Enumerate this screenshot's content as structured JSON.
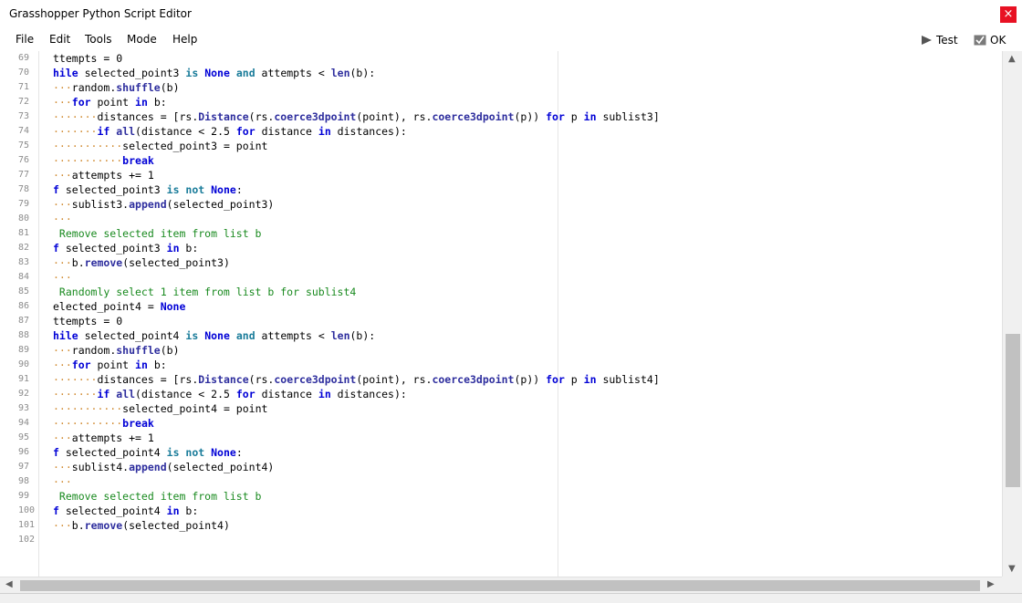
{
  "window": {
    "title": "Grasshopper Python Script Editor",
    "close_glyph": "×"
  },
  "menu": {
    "items": [
      "File",
      "Edit",
      "Tools",
      "Mode",
      "Help"
    ]
  },
  "toolbar": {
    "test_label": "Test",
    "ok_label": "OK"
  },
  "editor": {
    "lines": [
      {
        "n": "69",
        "segs": [
          [
            "",
            "ttempts = "
          ],
          [
            "num",
            "0"
          ]
        ]
      },
      {
        "n": "70",
        "segs": [
          [
            "kw",
            "hile"
          ],
          [
            "",
            " selected_point3 "
          ],
          [
            "ops",
            "is"
          ],
          [
            "",
            " "
          ],
          [
            "kw",
            "None"
          ],
          [
            "",
            " "
          ],
          [
            "ops",
            "and"
          ],
          [
            "",
            " attempts < "
          ],
          [
            "fn",
            "len"
          ],
          [
            "",
            "(b):"
          ]
        ]
      },
      {
        "n": "71",
        "segs": [
          [
            "ws",
            "···"
          ],
          [
            "",
            "random."
          ],
          [
            "fn",
            "shuffle"
          ],
          [
            "",
            "(b)"
          ]
        ]
      },
      {
        "n": "72",
        "segs": [
          [
            "ws",
            "···"
          ],
          [
            "kw",
            "for"
          ],
          [
            "",
            " point "
          ],
          [
            "kw",
            "in"
          ],
          [
            "",
            " b:"
          ]
        ]
      },
      {
        "n": "73",
        "segs": [
          [
            "ws",
            "·······"
          ],
          [
            "",
            "distances = [rs."
          ],
          [
            "fn",
            "Distance"
          ],
          [
            "",
            "(rs."
          ],
          [
            "fn",
            "coerce3dpoint"
          ],
          [
            "",
            "(point), rs."
          ],
          [
            "fn",
            "coerce3dpoint"
          ],
          [
            "",
            "(p)) "
          ],
          [
            "kw",
            "for"
          ],
          [
            "",
            " p "
          ],
          [
            "kw",
            "in"
          ],
          [
            "",
            " sublist3]"
          ]
        ]
      },
      {
        "n": "74",
        "segs": [
          [
            "ws",
            "·······"
          ],
          [
            "kw",
            "if"
          ],
          [
            "",
            " "
          ],
          [
            "fn",
            "all"
          ],
          [
            "",
            "(distance < "
          ],
          [
            "num",
            "2.5"
          ],
          [
            "",
            " "
          ],
          [
            "kw",
            "for"
          ],
          [
            "",
            " distance "
          ],
          [
            "kw",
            "in"
          ],
          [
            "",
            " distances):"
          ]
        ]
      },
      {
        "n": "75",
        "segs": [
          [
            "ws",
            "···········"
          ],
          [
            "",
            "selected_point3 = point"
          ]
        ]
      },
      {
        "n": "76",
        "segs": [
          [
            "ws",
            "···········"
          ],
          [
            "kw",
            "break"
          ]
        ]
      },
      {
        "n": "77",
        "segs": [
          [
            "ws",
            "···"
          ],
          [
            "",
            "attempts += "
          ],
          [
            "num",
            "1"
          ]
        ]
      },
      {
        "n": "78",
        "segs": [
          [
            "kw",
            "f"
          ],
          [
            "",
            " selected_point3 "
          ],
          [
            "ops",
            "is not"
          ],
          [
            "",
            " "
          ],
          [
            "kw",
            "None"
          ],
          [
            "",
            ":"
          ]
        ]
      },
      {
        "n": "79",
        "segs": [
          [
            "ws",
            "···"
          ],
          [
            "",
            "sublist3."
          ],
          [
            "fn",
            "append"
          ],
          [
            "",
            "(selected_point3)"
          ]
        ]
      },
      {
        "n": "80",
        "segs": [
          [
            "ws",
            "···"
          ]
        ]
      },
      {
        "n": "81",
        "segs": [
          [
            "cmt",
            " Remove selected item from list b"
          ]
        ]
      },
      {
        "n": "82",
        "segs": [
          [
            "kw",
            "f"
          ],
          [
            "",
            " selected_point3 "
          ],
          [
            "kw",
            "in"
          ],
          [
            "",
            " b:"
          ]
        ]
      },
      {
        "n": "83",
        "segs": [
          [
            "ws",
            "···"
          ],
          [
            "",
            "b."
          ],
          [
            "fn",
            "remove"
          ],
          [
            "",
            "(selected_point3)"
          ]
        ]
      },
      {
        "n": "84",
        "segs": [
          [
            "ws",
            "···"
          ]
        ]
      },
      {
        "n": "85",
        "segs": [
          [
            "cmt",
            " Randomly select 1 item from list b for sublist4"
          ]
        ]
      },
      {
        "n": "86",
        "segs": [
          [
            "",
            "elected_point4 = "
          ],
          [
            "kw",
            "None"
          ]
        ]
      },
      {
        "n": "87",
        "segs": [
          [
            "",
            "ttempts = "
          ],
          [
            "num",
            "0"
          ]
        ]
      },
      {
        "n": "88",
        "segs": [
          [
            "kw",
            "hile"
          ],
          [
            "",
            " selected_point4 "
          ],
          [
            "ops",
            "is"
          ],
          [
            "",
            " "
          ],
          [
            "kw",
            "None"
          ],
          [
            "",
            " "
          ],
          [
            "ops",
            "and"
          ],
          [
            "",
            " attempts < "
          ],
          [
            "fn",
            "len"
          ],
          [
            "",
            "(b):"
          ]
        ]
      },
      {
        "n": "89",
        "segs": [
          [
            "ws",
            "···"
          ],
          [
            "",
            "random."
          ],
          [
            "fn",
            "shuffle"
          ],
          [
            "",
            "(b)"
          ]
        ]
      },
      {
        "n": "90",
        "segs": [
          [
            "ws",
            "···"
          ],
          [
            "kw",
            "for"
          ],
          [
            "",
            " point "
          ],
          [
            "kw",
            "in"
          ],
          [
            "",
            " b:"
          ]
        ]
      },
      {
        "n": "91",
        "segs": [
          [
            "ws",
            "·······"
          ],
          [
            "",
            "distances = [rs."
          ],
          [
            "fn",
            "Distance"
          ],
          [
            "",
            "(rs."
          ],
          [
            "fn",
            "coerce3dpoint"
          ],
          [
            "",
            "(point), rs."
          ],
          [
            "fn",
            "coerce3dpoint"
          ],
          [
            "",
            "(p)) "
          ],
          [
            "kw",
            "for"
          ],
          [
            "",
            " p "
          ],
          [
            "kw",
            "in"
          ],
          [
            "",
            " sublist4]"
          ]
        ]
      },
      {
        "n": "92",
        "segs": [
          [
            "ws",
            "·······"
          ],
          [
            "kw",
            "if"
          ],
          [
            "",
            " "
          ],
          [
            "fn",
            "all"
          ],
          [
            "",
            "(distance < "
          ],
          [
            "num",
            "2.5"
          ],
          [
            "",
            " "
          ],
          [
            "kw",
            "for"
          ],
          [
            "",
            " distance "
          ],
          [
            "kw",
            "in"
          ],
          [
            "",
            " distances):"
          ]
        ]
      },
      {
        "n": "93",
        "segs": [
          [
            "ws",
            "···········"
          ],
          [
            "",
            "selected_point4 = point"
          ]
        ]
      },
      {
        "n": "94",
        "segs": [
          [
            "ws",
            "···········"
          ],
          [
            "kw",
            "break"
          ]
        ]
      },
      {
        "n": "95",
        "segs": [
          [
            "ws",
            "···"
          ],
          [
            "",
            "attempts += "
          ],
          [
            "num",
            "1"
          ]
        ]
      },
      {
        "n": "96",
        "segs": [
          [
            "kw",
            "f"
          ],
          [
            "",
            " selected_point4 "
          ],
          [
            "ops",
            "is not"
          ],
          [
            "",
            " "
          ],
          [
            "kw",
            "None"
          ],
          [
            "",
            ":"
          ]
        ]
      },
      {
        "n": "97",
        "segs": [
          [
            "ws",
            "···"
          ],
          [
            "",
            "sublist4."
          ],
          [
            "fn",
            "append"
          ],
          [
            "",
            "(selected_point4)"
          ]
        ]
      },
      {
        "n": "98",
        "segs": [
          [
            "ws",
            "···"
          ]
        ]
      },
      {
        "n": "99",
        "segs": [
          [
            "cmt",
            " Remove selected item from list b"
          ]
        ]
      },
      {
        "n": "100",
        "segs": [
          [
            "kw",
            "f"
          ],
          [
            "",
            " selected_point4 "
          ],
          [
            "kw",
            "in"
          ],
          [
            "",
            " b:"
          ]
        ]
      },
      {
        "n": "101",
        "segs": [
          [
            "ws",
            "···"
          ],
          [
            "",
            "b."
          ],
          [
            "fn",
            "remove"
          ],
          [
            "",
            "(selected_point4)"
          ]
        ]
      },
      {
        "n": "102",
        "segs": []
      }
    ]
  },
  "scrollbars": {
    "up": "▲",
    "down": "▼",
    "left": "◀",
    "right": "▶"
  }
}
